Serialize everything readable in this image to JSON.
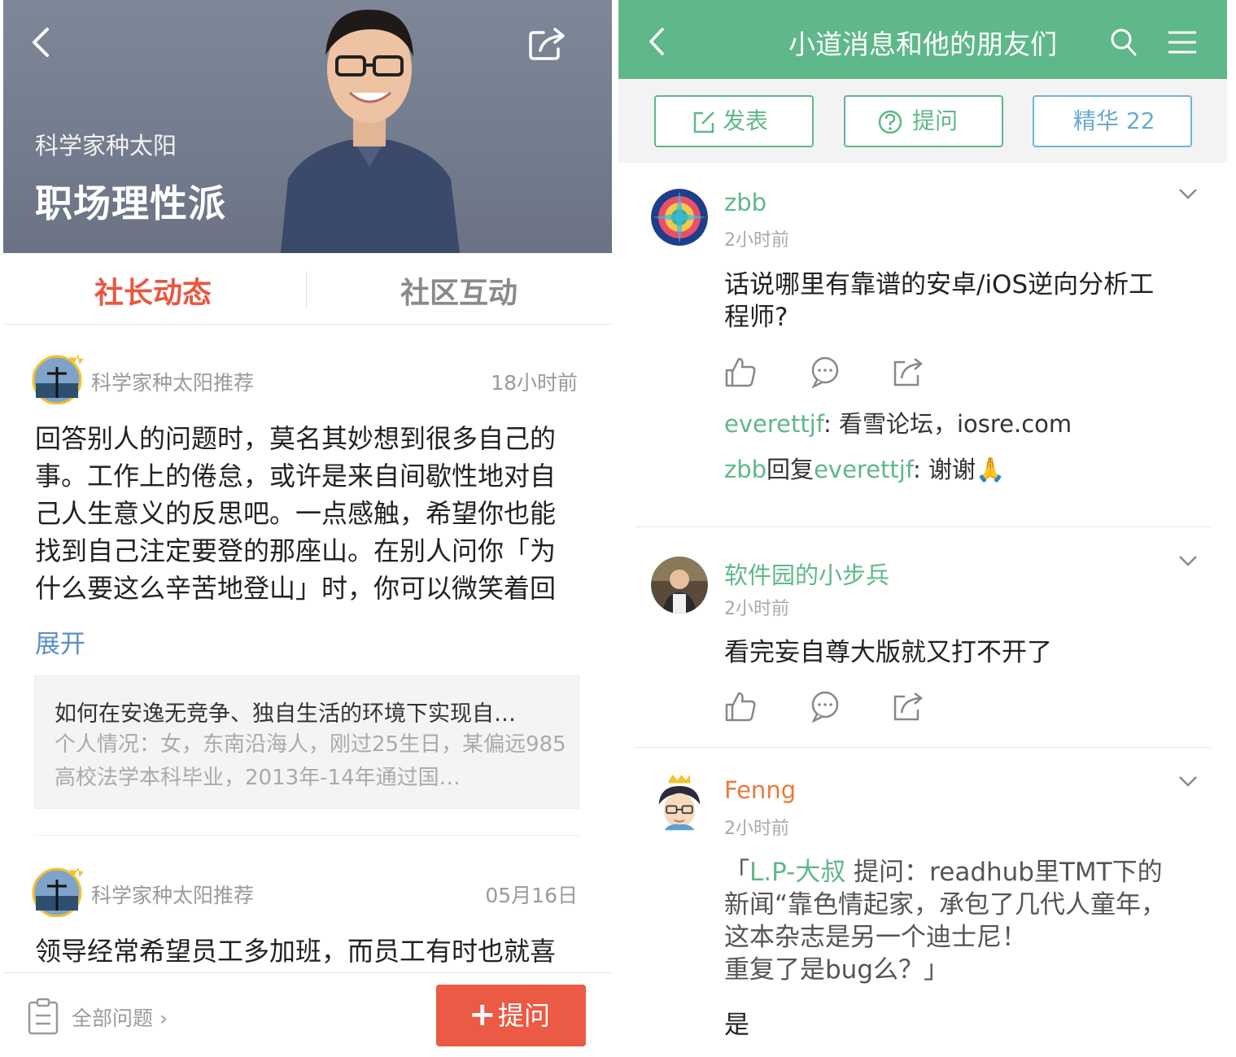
{
  "left": {
    "hero": {
      "subtitle": "科学家种太阳",
      "title": "职场理性派"
    },
    "tabs": [
      {
        "label": "社长动态"
      },
      {
        "label": "社区互动"
      }
    ],
    "posts": [
      {
        "author": "科学家种太阳推荐",
        "time": "18小时前",
        "lines": [
          "回答别人的问题时，莫名其妙想到很多自己的",
          "事。工作上的倦怠，或许是来自间歇性地对自",
          "己人生意义的反思吧。一点感触，希望你也能",
          "找到自己注定要登的那座山。在别人问你「为",
          "什么要这么辛苦地登山」时，你可以微笑着回"
        ],
        "expand": "展开",
        "quote_title": "如何在安逸无竞争、独自生活的环境下实现自…",
        "quote_excerpt": "个人情况：女，东南沿海人，刚过25生日，某偏远985高校法学本科毕业，2013年-14年通过国…"
      },
      {
        "author": "科学家种太阳推荐",
        "time": "05月16日",
        "first_line": "领导经常希望员工多加班，而员工有时也就喜"
      }
    ],
    "bottom": {
      "all_questions": "全部问题 ›",
      "ask_plus": "+",
      "ask_label": "提问"
    }
  },
  "right": {
    "navbar": {
      "title": "小道消息和他的朋友们"
    },
    "actions": [
      {
        "label": "发表"
      },
      {
        "label": "提问"
      },
      {
        "label": "精华 22"
      }
    ],
    "feed": [
      {
        "name": "zbb",
        "time": "2小时前",
        "lines": [
          "话说哪里有靠谱的安卓/iOS逆向分析工",
          "程师?"
        ],
        "comments": [
          {
            "user": "everettjf",
            "text": ": 看雪论坛，iosre.com"
          },
          {
            "user": "zbb",
            "reply_word": "回复",
            "reply_to": "everettjf",
            "text": ": 谢谢🙏"
          }
        ]
      },
      {
        "name": "软件园的小步兵",
        "time": "2小时前",
        "lines": [
          "看完妄自尊大版就又打不开了"
        ]
      },
      {
        "name": "Fenng",
        "time": "2小时前",
        "quote_open": "「",
        "quote_user": "L.P-大叔",
        "quote_rest": " 提问：readhub里TMT下的",
        "quote_lines": [
          "新闻“靠色情起家，承包了几代人童年，",
          "这本杂志是另一个迪士尼！",
          "重复了是bug么？」"
        ],
        "answer": "是"
      }
    ]
  },
  "colors": {
    "accent_orange": "#e9573f",
    "accent_green": "#5fb889",
    "link_blue": "#5b8fc6"
  }
}
